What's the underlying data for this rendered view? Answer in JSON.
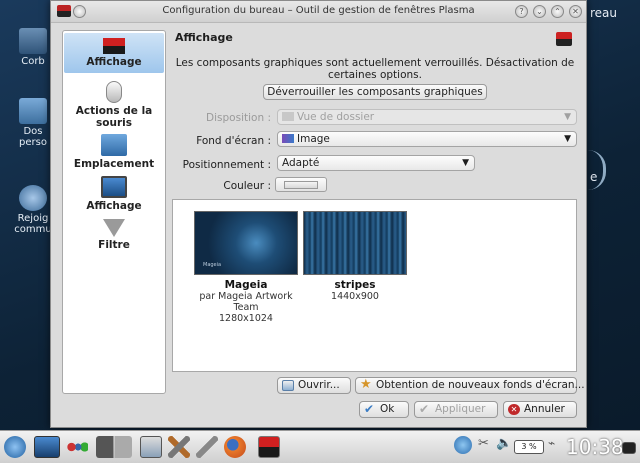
{
  "window": {
    "title": "Configuration du bureau – Outil de gestion de fenêtres Plasma"
  },
  "desktop": {
    "icons": [
      {
        "label": "Corb"
      },
      {
        "label": "Dos perso"
      },
      {
        "label": "Rejoig commu"
      }
    ],
    "right_text_top": "reau",
    "right_text_mid": "e"
  },
  "sidebar": {
    "items": [
      {
        "label": "Affichage",
        "icon": "wallpaper-flag-icon",
        "active": true
      },
      {
        "label": "Actions de la souris",
        "icon": "mouse-icon",
        "active": false
      },
      {
        "label": "Emplacement",
        "icon": "folder-icon",
        "active": false
      },
      {
        "label": "Affichage",
        "icon": "monitor-icon",
        "active": false
      },
      {
        "label": "Filtre",
        "icon": "funnel-icon",
        "active": false
      }
    ]
  },
  "content": {
    "header": "Affichage",
    "warning": "Les composants graphiques sont actuellement verrouillés. Désactivation de certaines options.",
    "unlock_button": "Déverrouiller les composants graphiques",
    "layout_label": "Disposition :",
    "layout_value": "Vue de dossier",
    "wallpaper_label": "Fond d'écran :",
    "wallpaper_value": "Image",
    "positioning_label": "Positionnement :",
    "positioning_value": "Adapté",
    "color_label": "Couleur :"
  },
  "gallery": {
    "items": [
      {
        "name": "Mageia",
        "author": "par Mageia Artwork Team",
        "size": "1280x1024",
        "thumb_text": "Mageia"
      },
      {
        "name": "stripes",
        "author": "",
        "size": "1440x900"
      }
    ]
  },
  "buttons": {
    "open": "Ouvrir...",
    "get_new": "Obtention de nouveaux fonds d'écran...",
    "ok": "Ok",
    "apply": "Appliquer",
    "cancel": "Annuler"
  },
  "taskbar": {
    "battery": "3 %",
    "clock": "10:38"
  },
  "colors": {
    "active_item": "#9ec6ec",
    "desktop_bg": "#0d2236",
    "cancel_icon": "#c0282a",
    "ok_icon": "#3a7cc4"
  }
}
